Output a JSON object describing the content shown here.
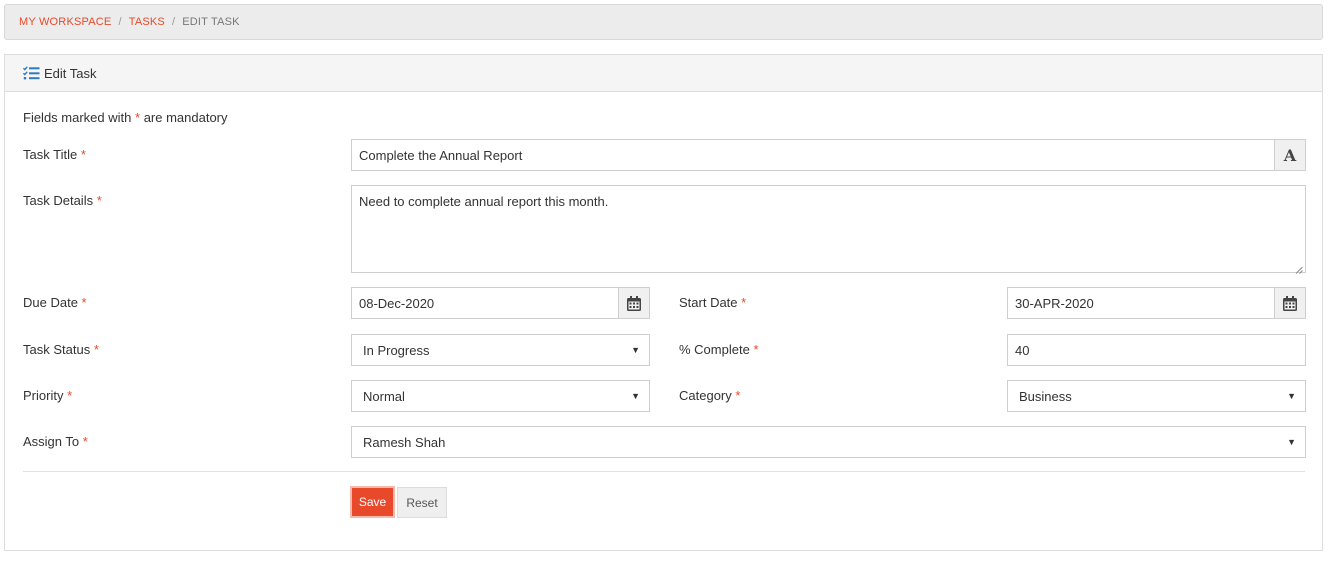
{
  "breadcrumb": {
    "items": [
      "My Workspace",
      "Tasks"
    ],
    "current": "Edit Task",
    "separator": "/"
  },
  "panel": {
    "title": "Edit Task",
    "icon": "task-list-icon"
  },
  "form": {
    "mandatory_note": {
      "prefix": "Fields marked with",
      "star": "*",
      "suffix": "are mandatory"
    },
    "required_marker": "*",
    "task_title": {
      "label": "Task Title",
      "value": "Complete the Annual Report",
      "addon_icon": "font-icon",
      "addon_text": "A"
    },
    "task_details": {
      "label": "Task Details",
      "value": "Need to complete annual report this month."
    },
    "due_date": {
      "label": "Due Date",
      "value": "08-Dec-2020",
      "addon_icon": "calendar-icon"
    },
    "start_date": {
      "label": "Start Date",
      "value": "30-APR-2020",
      "addon_icon": "calendar-icon"
    },
    "task_status": {
      "label": "Task Status",
      "value": "In Progress"
    },
    "percent_complete": {
      "label": "% Complete",
      "value": "40"
    },
    "priority": {
      "label": "Priority",
      "value": "Normal"
    },
    "category": {
      "label": "Category",
      "value": "Business"
    },
    "assign_to": {
      "label": "Assign To",
      "value": "Ramesh Shah"
    },
    "caret": "▼"
  },
  "buttons": {
    "save": "Save",
    "reset": "Reset"
  },
  "colors": {
    "accent": "#e8492a",
    "icon_blue": "#2f7bbf"
  }
}
